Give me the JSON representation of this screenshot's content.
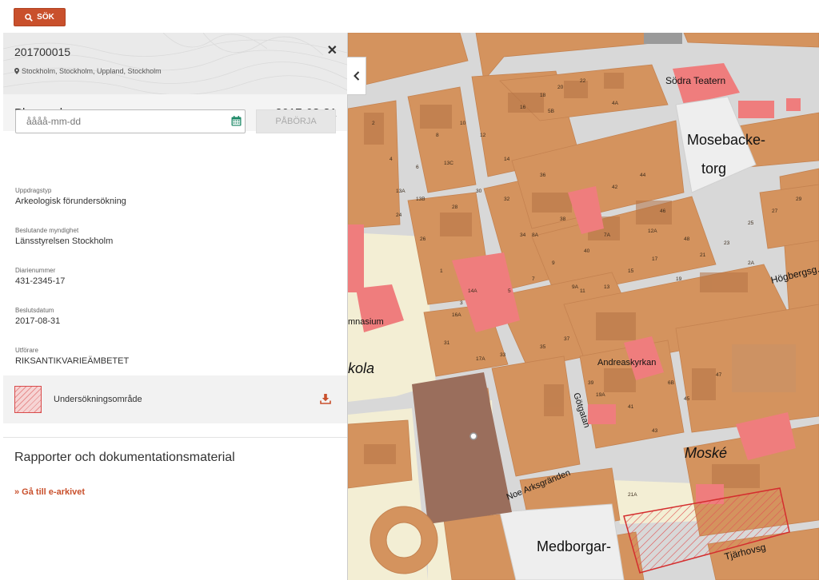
{
  "topbar": {
    "search_label": "SÖK"
  },
  "panel": {
    "case_id": "201700015",
    "location": "Stockholm, Stockholm, Uppland, Stockholm",
    "status": "Planerad",
    "status_date": "2017-08-31",
    "date_placeholder": "åååå-mm-dd",
    "start_label": "PÅBÖRJA",
    "fields": [
      {
        "label": "Uppdragstyp",
        "value": "Arkeologisk förundersökning"
      },
      {
        "label": "Beslutande myndighet",
        "value": "Länsstyrelsen Stockholm"
      },
      {
        "label": "Diarienummer",
        "value": "431-2345-17"
      },
      {
        "label": "Beslutsdatum",
        "value": "2017-08-31"
      },
      {
        "label": "Utförare",
        "value": "RIKSANTIKVARIEÄMBETET"
      }
    ],
    "area_label": "Undersökningsområde",
    "reports_title": "Rapporter och dokumentationsmaterial",
    "archive_link": "» Gå till e-arkivet"
  },
  "map": {
    "labels": {
      "sodra_teatern": "Södra Teatern",
      "mosebacke_1": "Mosebacke-",
      "mosebacke_2": "torg",
      "hogbergsg": "Högbergsg.",
      "andreaskyrkan": "Andreaskyrkan",
      "gymnasium": "mnasium",
      "skola": "kola",
      "gotgatan": "Götgatan",
      "noe_arksgranden": "Noe Arksgränden",
      "moske": "Moské",
      "medborgar": "Medborgar-",
      "tjarhovsg": "Tjärhovsg"
    },
    "house_numbers": [
      "2",
      "4",
      "6",
      "8",
      "10",
      "12",
      "14",
      "16",
      "18",
      "20",
      "22",
      "24",
      "26",
      "28",
      "30",
      "32",
      "34",
      "36",
      "38",
      "40",
      "42",
      "44",
      "46",
      "48",
      "1",
      "3",
      "5",
      "7",
      "9",
      "11",
      "13",
      "15",
      "17",
      "19",
      "21",
      "23",
      "25",
      "27",
      "29",
      "31",
      "33",
      "35",
      "37",
      "39",
      "41",
      "43",
      "45",
      "47",
      "13A",
      "13B",
      "13C",
      "14A",
      "16A",
      "17A",
      "12A",
      "7A",
      "5B",
      "4A",
      "8A",
      "2A",
      "9A",
      "6B",
      "19A",
      "21A"
    ],
    "colors": {
      "block": "#d4935e",
      "building": "#b57345",
      "street": "#d8d8d8",
      "park": "#f3eed4",
      "highlight": "#ef7d7d",
      "plaza": "#eeeeee",
      "church": "#9a6e5c"
    }
  }
}
